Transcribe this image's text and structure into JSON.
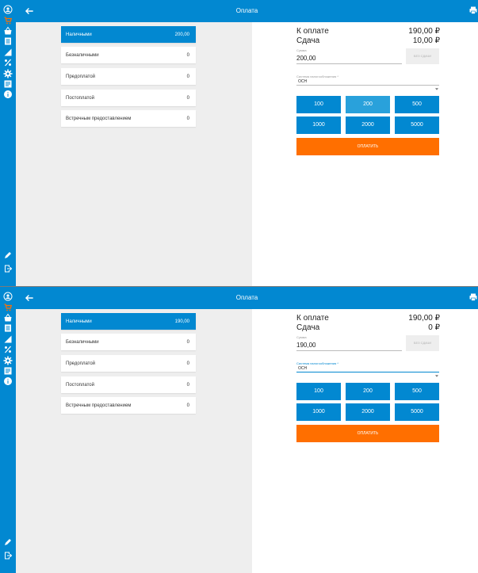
{
  "screens": [
    {
      "title": "Оплата",
      "payment_types": [
        {
          "label": "Наличными",
          "amount": "200,00",
          "active": true
        },
        {
          "label": "Безналичными",
          "amount": "0",
          "active": false
        },
        {
          "label": "Предоплатой",
          "amount": "0",
          "active": false
        },
        {
          "label": "Постоплатой",
          "amount": "0",
          "active": false
        },
        {
          "label": "Встречным предоставлением",
          "amount": "0",
          "active": false
        }
      ],
      "summary": {
        "due_label": "К оплате",
        "due_value": "190,00 ₽",
        "change_label": "Сдача",
        "change_value": "10,00 ₽"
      },
      "sum_field": {
        "caption": "Сумма",
        "value": "200,00"
      },
      "no_change_label": "БЕЗ СДАЧИ",
      "tax_field": {
        "caption": "Система налогообложения *",
        "value": "ОСН",
        "focused": false
      },
      "quick_amounts": [
        "100",
        "200",
        "500",
        "1000",
        "2000",
        "5000"
      ],
      "highlighted_amount": "200",
      "pay_label": "ОПЛАТИТЬ"
    },
    {
      "title": "Оплата",
      "payment_types": [
        {
          "label": "Наличными",
          "amount": "190,00",
          "active": true
        },
        {
          "label": "Безналичными",
          "amount": "0",
          "active": false
        },
        {
          "label": "Предоплатой",
          "amount": "0",
          "active": false
        },
        {
          "label": "Постоплатой",
          "amount": "0",
          "active": false
        },
        {
          "label": "Встречным предоставлением",
          "amount": "0",
          "active": false
        }
      ],
      "summary": {
        "due_label": "К оплате",
        "due_value": "190,00 ₽",
        "change_label": "Сдача",
        "change_value": "0 ₽"
      },
      "sum_field": {
        "caption": "Сумма",
        "value": "190,00"
      },
      "no_change_label": "БЕЗ СДАЧИ",
      "tax_field": {
        "caption": "Система налогообложения *",
        "value": "ОСН",
        "focused": true
      },
      "quick_amounts": [
        "100",
        "200",
        "500",
        "1000",
        "2000",
        "5000"
      ],
      "highlighted_amount": "",
      "pay_label": "ОПЛАТИТЬ"
    }
  ],
  "sidebar_icons": [
    "account-circle-icon",
    "cart-icon",
    "basket-icon",
    "list-icon",
    "receipt-icon",
    "percent-icon",
    "settings-icon",
    "report-icon",
    "info-icon",
    "edit-icon",
    "logout-icon"
  ],
  "colors": {
    "primary": "#0288d1",
    "primary_light": "#29a1db",
    "pay": "#ff6f00",
    "cart_active": "#ff6f00",
    "panel_bg": "#eeeeee"
  }
}
